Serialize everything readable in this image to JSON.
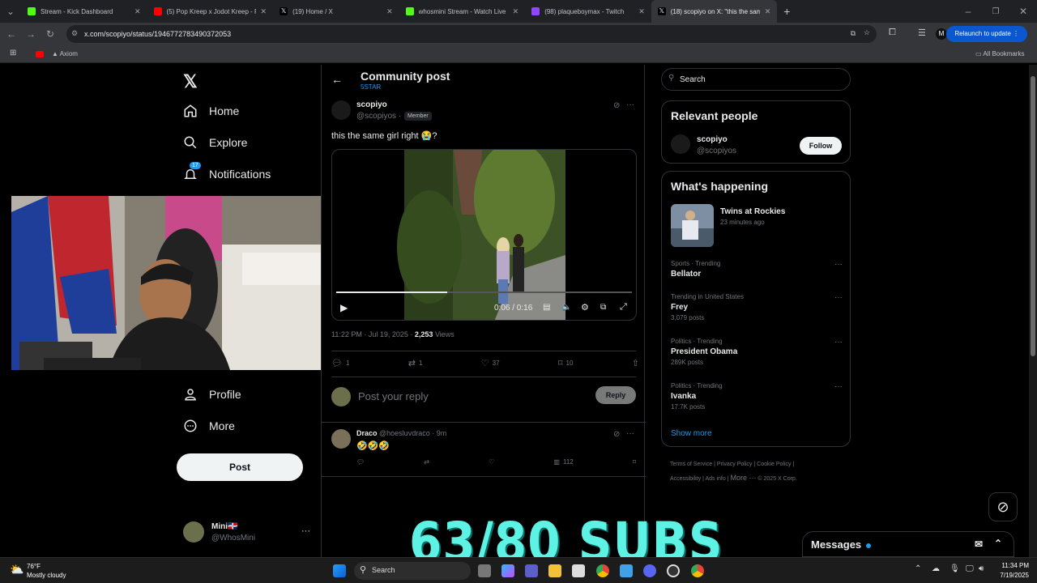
{
  "browser": {
    "tabs": [
      {
        "title": "Stream - Kick Dashboard",
        "color": "#53fc18"
      },
      {
        "title": "(5) Pop Kreep x Jodot Kreep - R",
        "color": "#ff0000"
      },
      {
        "title": "(19) Home / X",
        "color": "#ffffff"
      },
      {
        "title": "whosmini Stream - Watch Live o",
        "color": "#53fc18"
      },
      {
        "title": "(98) plaqueboymax - Twitch",
        "color": "#9146ff"
      },
      {
        "title": "(18) scopiyo on X: \"this the sam",
        "color": "#ffffff"
      }
    ],
    "url": "x.com/scopiyo/status/1946772783490372053",
    "relaunch_label": "Relaunch to update",
    "bookmark": "Axiom",
    "all_bookmarks": "All Bookmarks",
    "profile_initial": "M"
  },
  "nav": {
    "items": {
      "home": "Home",
      "explore": "Explore",
      "notifications": "Notifications",
      "profile": "Profile",
      "more": "More"
    },
    "notif_count": "17",
    "post_label": "Post",
    "account_name": "Mini🇩🇴",
    "account_handle": "@WhosMini"
  },
  "header": {
    "title": "Community post",
    "community": "5STAR"
  },
  "post": {
    "author": "scopiyo",
    "handle": "@scopiyos ·",
    "badge": "Member",
    "text": "this the same girl right 😭?",
    "video_time": "0:06 / 0:16",
    "video_progress": 0.375,
    "timestamp": "11:22 PM · Jul 19, 2025 ·",
    "views_count": "2,253",
    "views_label": "Views",
    "replies": "1",
    "reposts": "1",
    "likes": "37",
    "bookmarks": "10"
  },
  "reply_box": {
    "placeholder": "Post your reply",
    "button": "Reply"
  },
  "reply": {
    "author": "Draco",
    "handle": "@hoesluvdraco · 9m",
    "text": "🤣🤣🤣",
    "views": "112"
  },
  "sidebar": {
    "search_placeholder": "Search",
    "relevant_title": "Relevant people",
    "person_name": "scopiyo",
    "person_handle": "@scopiyos",
    "follow_label": "Follow",
    "happening_title": "What's happening",
    "featured_title": "Twins at Rockies",
    "featured_time": "23 minutes ago",
    "trends": [
      {
        "meta": "Sports · Trending",
        "name": "Bellator",
        "count": ""
      },
      {
        "meta": "Trending in United States",
        "name": "Frey",
        "count": "3,079 posts"
      },
      {
        "meta": "Politics · Trending",
        "name": "President Obama",
        "count": "289K posts"
      },
      {
        "meta": "Politics · Trending",
        "name": "Ivanka",
        "count": "17.7K posts"
      }
    ],
    "show_more": "Show more",
    "footer": [
      "Terms of Service",
      "Privacy Policy",
      "Cookie Policy",
      "Accessibility",
      "Ads info",
      "More ···",
      "© 2025 X Corp."
    ]
  },
  "messages_label": "Messages",
  "overlay_text": "63/80 SUBS",
  "taskbar": {
    "weather_temp": "76°F",
    "weather_desc": "Mostly cloudy",
    "search_label": "Search",
    "time": "11:34 PM",
    "date": "7/19/2025"
  }
}
